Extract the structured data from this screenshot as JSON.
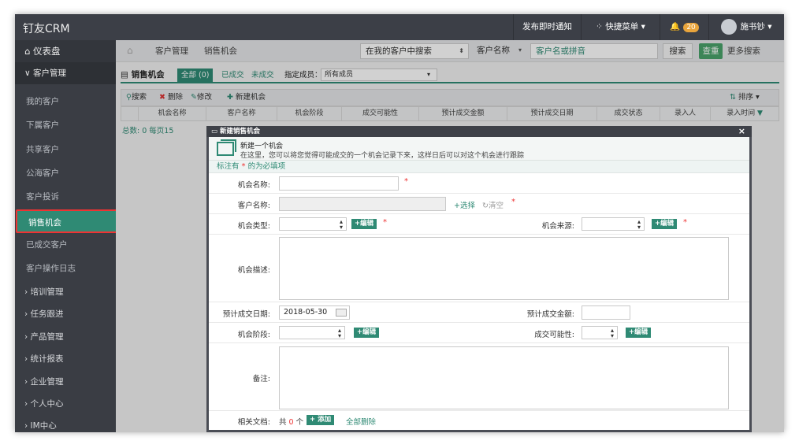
{
  "app": {
    "brand": "钉友CRM"
  },
  "topbar": {
    "notify": "发布即时通知",
    "quick_menu": "快捷菜单",
    "bell_count": "20",
    "user_name": "施书钞"
  },
  "sidebar": {
    "dashboard": "仪表盘",
    "group": "客户管理",
    "items": [
      "我的客户",
      "下属客户",
      "共享客户",
      "公海客户",
      "客户投诉",
      "销售机会",
      "已成交客户",
      "客户操作日志"
    ],
    "sections": [
      "培训管理",
      "任务跟进",
      "产品管理",
      "统计报表",
      "企业管理",
      "个人中心",
      "IM中心"
    ]
  },
  "breadcrumb": {
    "level1": "客户管理",
    "level2": "销售机会"
  },
  "search": {
    "scope": "在我的客户中搜索",
    "field": "客户名称",
    "placeholder": "客户名或拼音",
    "search_btn": "搜索",
    "reset_btn": "查重",
    "more_btn": "更多搜索"
  },
  "tabs": {
    "title": "销售机会",
    "all": "全部 (0)",
    "done": "已成交",
    "undone": "未成交",
    "member_label": "指定成员：",
    "member_value": "所有成员"
  },
  "toolbar": {
    "search": "搜索",
    "delete": "删除",
    "edit": "修改",
    "new": "新建机会",
    "sort": "排序"
  },
  "table": {
    "headers": [
      "机会名称",
      "客户名称",
      "机会阶段",
      "成交可能性",
      "预计成交金额",
      "预计成交日期",
      "成交状态",
      "录入人",
      "录入时间"
    ],
    "summary": "总数: 0 每页15"
  },
  "modal": {
    "title": "新建销售机会",
    "intro_title": "新建一个机会",
    "intro_desc": "在这里，您可以将您觉得可能成交的一个机会记录下来，这样日后可以对这个机会进行跟踪",
    "required_note_pre": "标注有",
    "required_star": "*",
    "required_note_post": "的为必填项",
    "labels": {
      "name": "机会名称:",
      "customer": "客户名称:",
      "type": "机会类型:",
      "source": "机会来源:",
      "desc": "机会描述:",
      "date": "预计成交日期:",
      "amount": "预计成交金额:",
      "stage": "机会阶段:",
      "possibility": "成交可能性:",
      "note": "备注:",
      "docs": "相关文档:"
    },
    "values": {
      "name": "",
      "customer": "",
      "date": "2018-05-30",
      "amount": ""
    },
    "choose": "+选择",
    "clear": "清空",
    "edit_btn": "+编辑",
    "docs_count_pre": "共",
    "docs_count": "0",
    "docs_count_post": "个",
    "add_btn": "+ 添加",
    "delete_all": "全部删除"
  }
}
